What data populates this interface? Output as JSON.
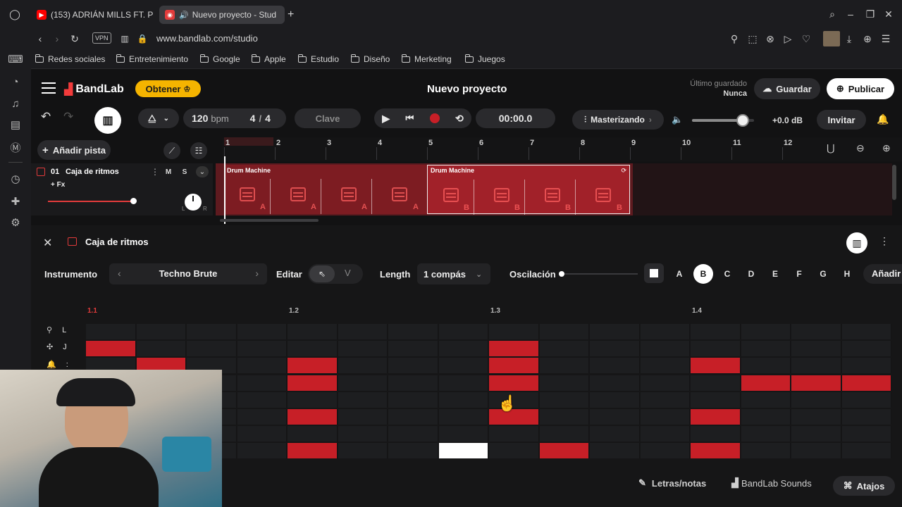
{
  "browser": {
    "tabs": [
      {
        "title": "(153) ADRIÁN MILLS FT. P",
        "active": false
      },
      {
        "title": "Nuevo proyecto - Stud",
        "active": true
      }
    ],
    "new_tab": "+",
    "url": "www.bandlab.com/studio",
    "vpn_label": "VPN",
    "bookmarks": [
      "Redes sociales",
      "Entretenimiento",
      "Google",
      "Apple",
      "Estudio",
      "Diseño",
      "Merketing",
      "Juegos"
    ]
  },
  "header": {
    "logo": "BandLab",
    "obtener": "Obtener",
    "project_title": "Nuevo proyecto",
    "saved_label": "Último guardado",
    "saved_value": "Nunca",
    "save_button": "Guardar",
    "publish_button": "Publicar"
  },
  "transport": {
    "tempo": "120",
    "tempo_unit": "bpm",
    "time_sig_num": "4",
    "time_sig_sep": "/",
    "time_sig_den": "4",
    "key_button": "Clave",
    "time": "00:00.0",
    "mastering": "Masterizando",
    "volume_db": "+0.0 dB",
    "volume_level": 0.82,
    "invite": "Invitar"
  },
  "tracks": {
    "add_track": "Añadir pista",
    "ruler": [
      "1",
      "2",
      "3",
      "4",
      "5",
      "6",
      "7",
      "8",
      "9",
      "10",
      "11",
      "12"
    ],
    "track": {
      "number": "01",
      "name": "Caja de ritmos",
      "fx": "+ Fx",
      "mute": "M",
      "solo": "S",
      "pan_left": "L",
      "pan_right": "R",
      "volume_level": 1.0
    },
    "clips": [
      {
        "label": "Drum Machine",
        "pattern": "A"
      },
      {
        "label": "Drum Machine",
        "pattern": "B"
      }
    ]
  },
  "drum_editor": {
    "title": "Caja de ritmos",
    "instrument_label": "Instrumento",
    "instrument_value": "Techno Brute",
    "edit_label": "Editar",
    "edit_alt": "V",
    "length_label": "Length",
    "length_value": "1 compás",
    "swing_label": "Oscilación",
    "swing_level": 0.0,
    "patterns": [
      "A",
      "B",
      "C",
      "D",
      "E",
      "F",
      "G",
      "H"
    ],
    "active_pattern": "B",
    "add_pattern": "Añadir",
    "beats": [
      "1.1",
      "1.2",
      "1.3",
      "1.4"
    ],
    "row_labels": [
      {
        "icon": "drum-icon",
        "key": "L"
      },
      {
        "icon": "plus-arrows-icon",
        "key": "J"
      },
      {
        "icon": "bell-icon",
        "key": ":"
      }
    ],
    "grid_rows": [
      [
        0,
        0,
        0,
        0,
        0,
        0,
        0,
        0,
        0,
        0,
        0,
        0,
        0,
        0,
        0,
        0
      ],
      [
        1,
        0,
        0,
        0,
        0,
        0,
        0,
        0,
        1,
        0,
        0,
        0,
        0,
        0,
        0,
        0
      ],
      [
        0,
        1,
        0,
        0,
        1,
        0,
        0,
        0,
        1,
        0,
        0,
        0,
        1,
        0,
        0,
        0
      ],
      [
        0,
        0,
        0,
        0,
        1,
        0,
        0,
        0,
        1,
        0,
        0,
        0,
        0,
        1,
        1,
        1
      ],
      [
        0,
        0,
        0,
        0,
        0,
        0,
        0,
        0,
        0,
        0,
        0,
        0,
        0,
        0,
        0,
        0
      ],
      [
        0,
        0,
        0,
        0,
        1,
        0,
        0,
        0,
        1,
        0,
        0,
        0,
        1,
        0,
        0,
        0
      ],
      [
        0,
        0,
        0,
        0,
        0,
        0,
        0,
        0,
        0,
        0,
        0,
        0,
        0,
        0,
        0,
        0
      ],
      [
        1,
        0,
        0,
        0,
        1,
        0,
        0,
        2,
        0,
        1,
        0,
        0,
        1,
        0,
        0,
        0
      ]
    ]
  },
  "footer": {
    "lyrics": "Letras/notas",
    "sounds": "BandLab Sounds",
    "shortcuts": "Atajos"
  },
  "colors": {
    "accent": "#c71f27",
    "active_pattern_bg": "#ffffff"
  }
}
